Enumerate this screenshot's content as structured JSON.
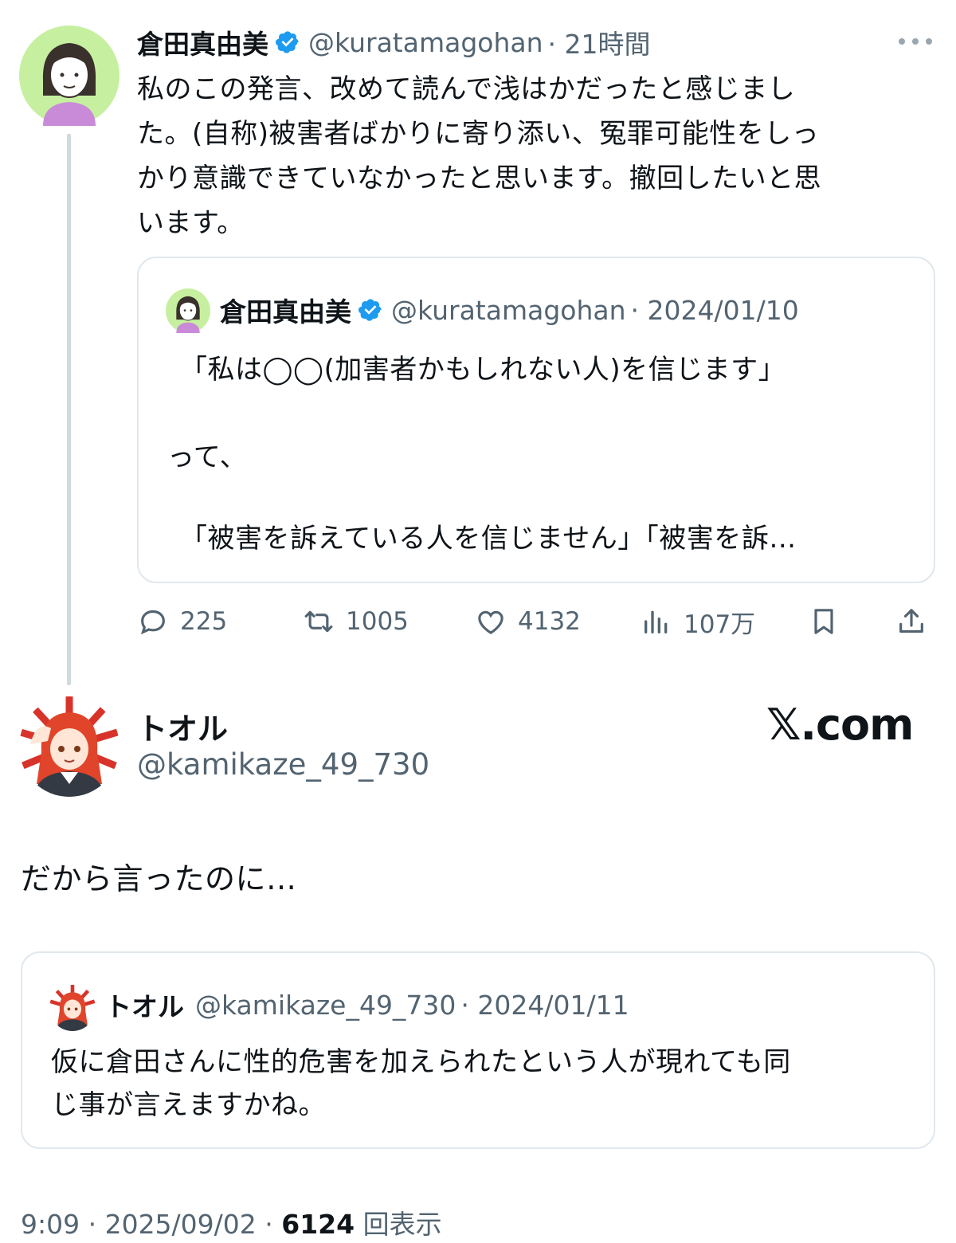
{
  "parent_tweet": {
    "author_name": "倉田真由美",
    "handle": "@kuratamagohan",
    "time": "· 21時間",
    "lines": [
      "私のこの発言、改めて読んで浅はかだったと感じまし",
      "た。(自称)被害者ばかりに寄り添い、冤罪可能性をしっ",
      "かり意識できていなかったと思います。撤回したいと思",
      "います。"
    ],
    "quoted": {
      "author_name": "倉田真由美",
      "handle": "@kuratamagohan",
      "date": "· 2024/01/10",
      "line1": "「私は◯◯(加害者かもしれない人)を信じます」",
      "line2": "って、",
      "line3": "「被害を訴えている人を信じません」「被害を訴…"
    },
    "stats": {
      "replies": "225",
      "retweets": "1005",
      "likes": "4132",
      "views": "107万"
    }
  },
  "main_tweet": {
    "author_name": "トオル",
    "handle": "@kamikaze_49_730",
    "watermark": "𝕏.com",
    "text": "だから言ったのに…",
    "quoted": {
      "author_name": "トオル",
      "handle": "@kamikaze_49_730",
      "date": "· 2024/01/11",
      "lines": [
        "仮に倉田さんに性的危害を加えられたという人が現れても同",
        "じ事が言えますかね。"
      ]
    },
    "footer": {
      "time": "9:09 · 2025/09/02 · ",
      "views_count": "6124",
      "views_label": " 回表示"
    }
  },
  "colors": {
    "text": "#0f1419",
    "muted": "#536471",
    "verified": "#1d9bf0",
    "border": "#e1e8ed",
    "thread_line": "#cfd9de"
  },
  "icons": [
    "verified-badge-icon",
    "more-icon",
    "reply-icon",
    "retweet-icon",
    "like-icon",
    "views-icon",
    "bookmark-icon",
    "share-icon"
  ]
}
